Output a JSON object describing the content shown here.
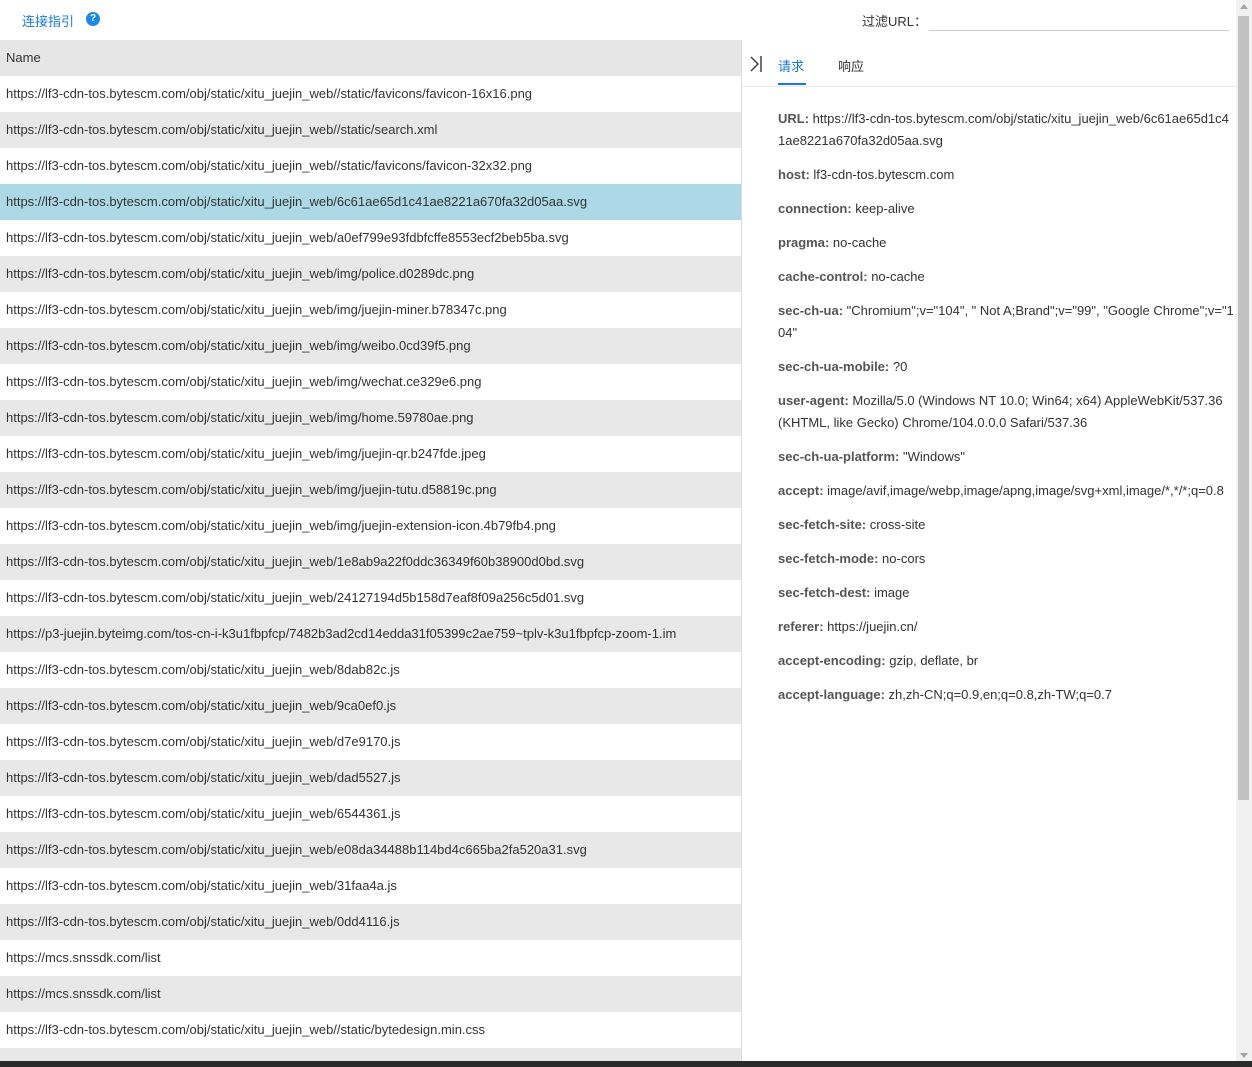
{
  "toolbar": {
    "guide_label": "连接指引",
    "help_glyph": "?",
    "filter_label": "过滤URL：",
    "filter_value": ""
  },
  "list": {
    "header": "Name",
    "selected_index": 3,
    "rows": [
      "https://lf3-cdn-tos.bytescm.com/obj/static/xitu_juejin_web//static/favicons/favicon-16x16.png",
      "https://lf3-cdn-tos.bytescm.com/obj/static/xitu_juejin_web//static/search.xml",
      "https://lf3-cdn-tos.bytescm.com/obj/static/xitu_juejin_web//static/favicons/favicon-32x32.png",
      "https://lf3-cdn-tos.bytescm.com/obj/static/xitu_juejin_web/6c61ae65d1c41ae8221a670fa32d05aa.svg",
      "https://lf3-cdn-tos.bytescm.com/obj/static/xitu_juejin_web/a0ef799e93fdbfcffe8553ecf2beb5ba.svg",
      "https://lf3-cdn-tos.bytescm.com/obj/static/xitu_juejin_web/img/police.d0289dc.png",
      "https://lf3-cdn-tos.bytescm.com/obj/static/xitu_juejin_web/img/juejin-miner.b78347c.png",
      "https://lf3-cdn-tos.bytescm.com/obj/static/xitu_juejin_web/img/weibo.0cd39f5.png",
      "https://lf3-cdn-tos.bytescm.com/obj/static/xitu_juejin_web/img/wechat.ce329e6.png",
      "https://lf3-cdn-tos.bytescm.com/obj/static/xitu_juejin_web/img/home.59780ae.png",
      "https://lf3-cdn-tos.bytescm.com/obj/static/xitu_juejin_web/img/juejin-qr.b247fde.jpeg",
      "https://lf3-cdn-tos.bytescm.com/obj/static/xitu_juejin_web/img/juejin-tutu.d58819c.png",
      "https://lf3-cdn-tos.bytescm.com/obj/static/xitu_juejin_web/img/juejin-extension-icon.4b79fb4.png",
      "https://lf3-cdn-tos.bytescm.com/obj/static/xitu_juejin_web/1e8ab9a22f0ddc36349f60b38900d0bd.svg",
      "https://lf3-cdn-tos.bytescm.com/obj/static/xitu_juejin_web/24127194d5b158d7eaf8f09a256c5d01.svg",
      "https://p3-juejin.byteimg.com/tos-cn-i-k3u1fbpfcp/7482b3ad2cd14edda31f05399c2ae759~tplv-k3u1fbpfcp-zoom-1.im",
      "https://lf3-cdn-tos.bytescm.com/obj/static/xitu_juejin_web/8dab82c.js",
      "https://lf3-cdn-tos.bytescm.com/obj/static/xitu_juejin_web/9ca0ef0.js",
      "https://lf3-cdn-tos.bytescm.com/obj/static/xitu_juejin_web/d7e9170.js",
      "https://lf3-cdn-tos.bytescm.com/obj/static/xitu_juejin_web/dad5527.js",
      "https://lf3-cdn-tos.bytescm.com/obj/static/xitu_juejin_web/6544361.js",
      "https://lf3-cdn-tos.bytescm.com/obj/static/xitu_juejin_web/e08da34488b114bd4c665ba2fa520a31.svg",
      "https://lf3-cdn-tos.bytescm.com/obj/static/xitu_juejin_web/31faa4a.js",
      "https://lf3-cdn-tos.bytescm.com/obj/static/xitu_juejin_web/0dd4116.js",
      "https://mcs.snssdk.com/list",
      "https://mcs.snssdk.com/list",
      "https://lf3-cdn-tos.bytescm.com/obj/static/xitu_juejin_web//static/bytedesign.min.css",
      ""
    ]
  },
  "detail": {
    "tabs": [
      "请求",
      "响应"
    ],
    "active_tab": 0,
    "collapse_icon": "collapse-right-icon",
    "headers": [
      {
        "key": "URL:",
        "value": "https://lf3-cdn-tos.bytescm.com/obj/static/xitu_juejin_web/6c61ae65d1c41ae8221a670fa32d05aa.svg"
      },
      {
        "key": "host:",
        "value": "lf3-cdn-tos.bytescm.com"
      },
      {
        "key": "connection:",
        "value": "keep-alive"
      },
      {
        "key": "pragma:",
        "value": "no-cache"
      },
      {
        "key": "cache-control:",
        "value": "no-cache"
      },
      {
        "key": "sec-ch-ua:",
        "value": "\"Chromium\";v=\"104\", \" Not A;Brand\";v=\"99\", \"Google Chrome\";v=\"104\""
      },
      {
        "key": "sec-ch-ua-mobile:",
        "value": "?0"
      },
      {
        "key": "user-agent:",
        "value": "Mozilla/5.0 (Windows NT 10.0; Win64; x64) AppleWebKit/537.36 (KHTML, like Gecko) Chrome/104.0.0.0 Safari/537.36"
      },
      {
        "key": "sec-ch-ua-platform:",
        "value": "\"Windows\""
      },
      {
        "key": "accept:",
        "value": "image/avif,image/webp,image/apng,image/svg+xml,image/*,*/*;q=0.8"
      },
      {
        "key": "sec-fetch-site:",
        "value": "cross-site"
      },
      {
        "key": "sec-fetch-mode:",
        "value": "no-cors"
      },
      {
        "key": "sec-fetch-dest:",
        "value": "image"
      },
      {
        "key": "referer:",
        "value": "https://juejin.cn/"
      },
      {
        "key": "accept-encoding:",
        "value": "gzip, deflate, br"
      },
      {
        "key": "accept-language:",
        "value": "zh,zh-CN;q=0.9,en;q=0.8,zh-TW;q=0.7"
      }
    ]
  },
  "colors": {
    "accent": "#1a7ad6",
    "selected_row": "#add8e6",
    "alt_row": "#e8e8e8"
  }
}
